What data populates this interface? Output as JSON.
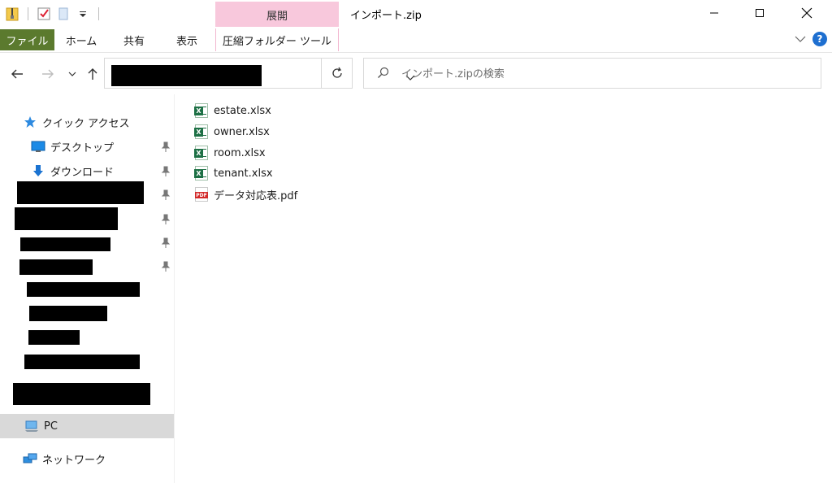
{
  "window": {
    "title": "インポート.zip",
    "context_tab_label": "展開"
  },
  "ribbon": {
    "tabs": [
      {
        "label": "ファイル"
      },
      {
        "label": "ホーム"
      },
      {
        "label": "共有"
      },
      {
        "label": "表示"
      },
      {
        "label": "圧縮フォルダー ツール"
      }
    ]
  },
  "search": {
    "placeholder": "インポート.zipの検索"
  },
  "nav": {
    "quick_access": "クイック アクセス",
    "desktop": "デスクトップ",
    "downloads": "ダウンロード",
    "pc": "PC",
    "network": "ネットワーク"
  },
  "files": [
    {
      "name": "estate.xlsx",
      "type": "excel"
    },
    {
      "name": "owner.xlsx",
      "type": "excel"
    },
    {
      "name": "room.xlsx",
      "type": "excel"
    },
    {
      "name": "tenant.xlsx",
      "type": "excel"
    },
    {
      "name": "データ対応表.pdf",
      "type": "pdf"
    }
  ],
  "colors": {
    "file_tab": "#5b7a2e",
    "context_tab": "#f8c8dc",
    "selected_nav": "#d9d9d9",
    "help": "#1e6fd0"
  }
}
